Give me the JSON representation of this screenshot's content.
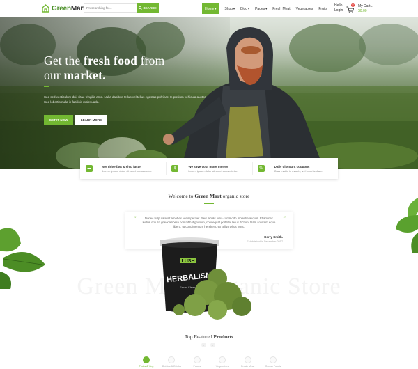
{
  "colors": {
    "accent": "#73b832",
    "badge": "#e2403a",
    "dark": "#333333"
  },
  "header": {
    "logo": {
      "part1": "Green",
      "part2": "Mart",
      "icon": "house-leaf-icon"
    },
    "search": {
      "placeholder": "I'm searching for...",
      "button": "SEARCH",
      "icon": "search-icon"
    },
    "nav": [
      {
        "label": "Home",
        "dropdown": true,
        "active": true
      },
      {
        "label": "Shop",
        "dropdown": true
      },
      {
        "label": "Blog",
        "dropdown": true
      },
      {
        "label": "Pages",
        "dropdown": true
      },
      {
        "label": "Fresh Meat",
        "dropdown": false
      },
      {
        "label": "Vegetables",
        "dropdown": false
      },
      {
        "label": "Fruits",
        "dropdown": false
      }
    ],
    "account": {
      "hello": "Hello",
      "login": "Login"
    },
    "cart": {
      "count": "0",
      "label": "My Cart",
      "total": "$0.00",
      "icon": "cart-icon"
    }
  },
  "hero": {
    "title_line1_pre": "Get the ",
    "title_line1_bold": "fresh food",
    "title_line1_post": " from",
    "title_line2_pre": "our ",
    "title_line2_bold": "market.",
    "text": "Sed sed vestibulum dui, vitae fringilla ante. Nulla dapibus tellus vel tellus egestas pulvinar. In pretium vehicula auctor. Sed lobortis nulla in facilisis malesuada.",
    "button_primary": "GET IT NOW",
    "button_secondary": "LEARN MORE"
  },
  "features": [
    {
      "icon": "truck-icon",
      "title": "We drive fast & ship faster",
      "subtitle": "Lorem ipsum dolor sit amet consectetur."
    },
    {
      "icon": "money-bag-icon",
      "title": "We save your more money",
      "subtitle": "Lorem ipsum dolor sit amet consectetur."
    },
    {
      "icon": "coupon-icon",
      "title": "Daily discount coupons",
      "subtitle": "Cras mattis in mauris, vel lobortis diam."
    }
  ],
  "welcome": {
    "title_pre": "Welcome to ",
    "title_bold": "Green Mart",
    "title_post": " organic store",
    "quote": "Donec vulputate sit amet ex vel imperdiet. Sed iaculis urna commodo molestie aliquet. Etiam nec lectus orci. In gravida libero non nibh dignissim, consequat porttitor lacus dictum. Nam solorem eque libero, ut condimentum hendrerit, ex tellus tellus nunc.",
    "author": "Kerry Smith.",
    "role": "Established in December 2017",
    "watermark": "Green Mart Organic Store"
  },
  "product": {
    "brand": "LUSH",
    "name": "HERBALISM",
    "subtitle": "Facial Cleanser"
  },
  "featured": {
    "title_pre": "Top Featured ",
    "title_bold": "Products",
    "categories": [
      {
        "label": "Fruits & Veg",
        "active": true
      },
      {
        "label": "Bottles & Drinks",
        "active": false
      },
      {
        "label": "Foods",
        "active": false
      },
      {
        "label": "Vegetables",
        "active": false
      },
      {
        "label": "Fresh Meat",
        "active": false
      },
      {
        "label": "Ocean Foods",
        "active": false
      }
    ]
  }
}
